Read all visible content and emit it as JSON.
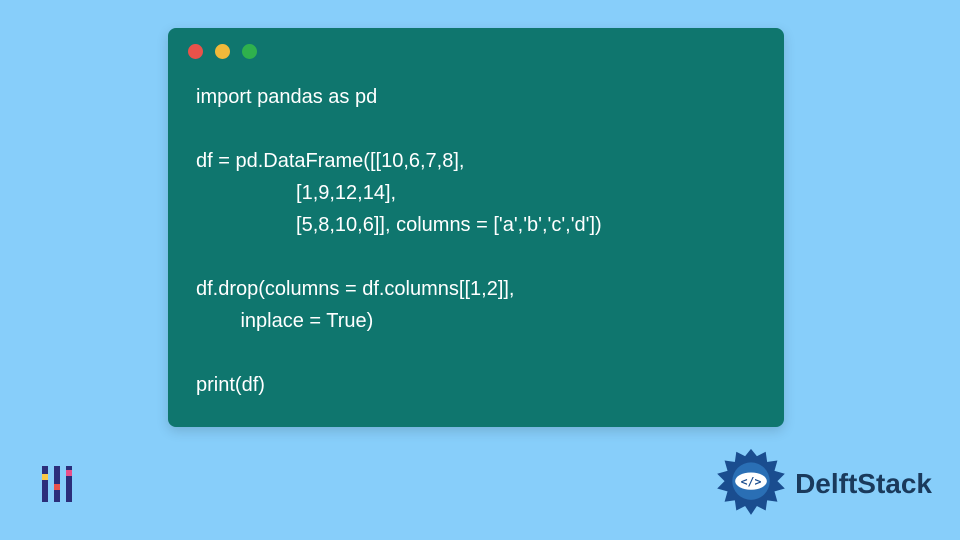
{
  "code": {
    "lines": [
      "import pandas as pd",
      "",
      "df = pd.DataFrame([[10,6,7,8],",
      "                  [1,9,12,14],",
      "                  [5,8,10,6]], columns = ['a','b','c','d'])",
      "",
      "df.drop(columns = df.columns[[1,2]],",
      "        inplace = True)",
      "",
      "print(df)"
    ]
  },
  "window": {
    "dots": [
      "red",
      "yellow",
      "green"
    ]
  },
  "brand": {
    "name": "DelftStack"
  },
  "colors": {
    "background": "#87cefa",
    "code_bg": "#0f766e",
    "code_fg": "#ffffff",
    "brand_text": "#1a3a5c"
  }
}
